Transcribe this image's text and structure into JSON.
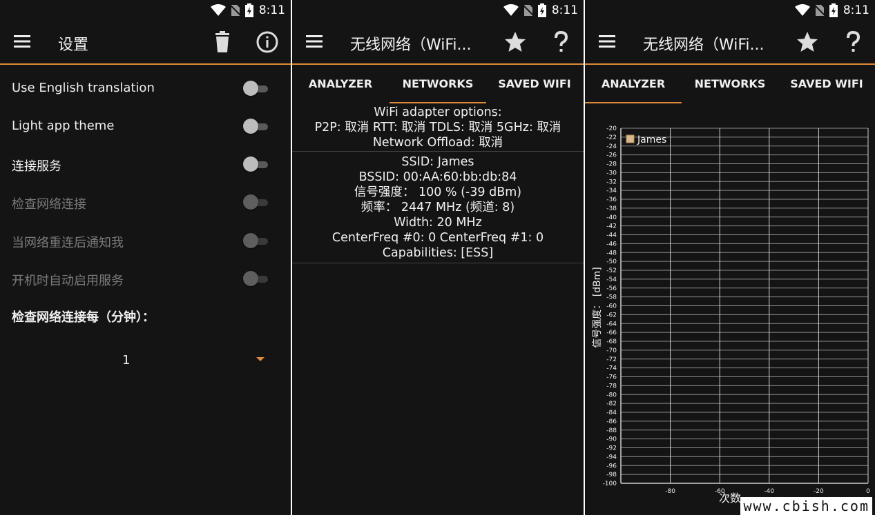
{
  "status": {
    "time": "8:11"
  },
  "colors": {
    "background": "#141414",
    "accent": "#e08a3a",
    "text": "#f0f0f0",
    "disabled": "#7a7a7a",
    "series": "#d9b88a"
  },
  "settings_panel": {
    "title": "设置",
    "icons": [
      "menu-icon",
      "trash-icon",
      "info-icon"
    ],
    "items": [
      {
        "label": "Use English translation",
        "enabled": true,
        "on": false
      },
      {
        "label": "Light app theme",
        "enabled": true,
        "on": false
      },
      {
        "label": "连接服务",
        "enabled": true,
        "on": false
      },
      {
        "label": "检查网络连接",
        "enabled": false,
        "on": false
      },
      {
        "label": "当网络重连后通知我",
        "enabled": false,
        "on": false
      },
      {
        "label": "开机时自动启用服务",
        "enabled": false,
        "on": false
      }
    ],
    "interval_label": "检查网络连接每（分钟）：",
    "interval_value": "1"
  },
  "networks_panel": {
    "title": "无线网络（WiFi...",
    "icons": [
      "menu-icon",
      "star-icon",
      "help-icon"
    ],
    "tabs": [
      "ANALYZER",
      "NETWORKS",
      "SAVED WIFI"
    ],
    "active_tab": 1,
    "adapter_lines": [
      "WiFi adapter options:",
      "P2P: 取消 RTT: 取消 TDLS: 取消 5GHz: 取消",
      "Network Offload: 取消"
    ],
    "network_lines": [
      "SSID: James",
      "BSSID: 00:AA:60:bb:db:84",
      "信号强度：  100 % (-39 dBm)",
      "频率：  2447 MHz (频道: 8)",
      "Width: 20 MHz",
      "CenterFreq #0: 0 CenterFreq #1: 0",
      "Capabilities: [ESS]"
    ]
  },
  "analyzer_panel": {
    "title": "无线网络（WiFi...",
    "icons": [
      "menu-icon",
      "star-icon",
      "help-icon"
    ],
    "tabs": [
      "ANALYZER",
      "NETWORKS",
      "SAVED WIFI"
    ],
    "active_tab": 0,
    "watermark": "www.cbish.com"
  },
  "chart_data": {
    "type": "line",
    "title": "",
    "xlabel": "次数",
    "ylabel": "信号强度：  [dBm]",
    "xlim": [
      -100,
      0
    ],
    "ylim": [
      -100,
      -20
    ],
    "x_ticks": [
      -80,
      -60,
      -40,
      -20,
      0
    ],
    "y_ticks": [
      -20,
      -22,
      -24,
      -26,
      -28,
      -30,
      -32,
      -34,
      -36,
      -38,
      -40,
      -42,
      -44,
      -46,
      -48,
      -50,
      -52,
      -54,
      -56,
      -58,
      -60,
      -62,
      -64,
      -66,
      -68,
      -70,
      -72,
      -74,
      -76,
      -78,
      -80,
      -82,
      -84,
      -86,
      -88,
      -90,
      -92,
      -94,
      -96,
      -98,
      -100
    ],
    "grid": true,
    "legend": "top-left",
    "series": [
      {
        "name": "James",
        "x": [],
        "y": []
      }
    ]
  }
}
